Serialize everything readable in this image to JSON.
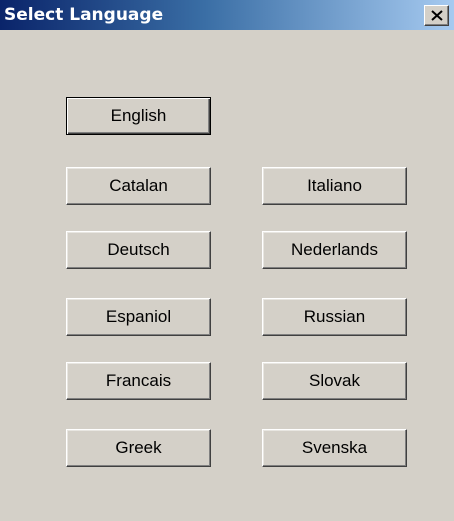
{
  "window": {
    "title": "Select Language",
    "close_label": "×"
  },
  "buttons": {
    "english": "English",
    "catalan": "Catalan",
    "italiano": "Italiano",
    "deutsch": "Deutsch",
    "nederlands": "Nederlands",
    "espaniol": "Espaniol",
    "russian": "Russian",
    "francais": "Francais",
    "slovak": "Slovak",
    "greek": "Greek",
    "svenska": "Svenska"
  },
  "colors": {
    "titlebar_start": "#0a246a",
    "titlebar_end": "#a6caf0",
    "face": "#d4d0c8"
  },
  "icons": {
    "close": "close-icon"
  }
}
